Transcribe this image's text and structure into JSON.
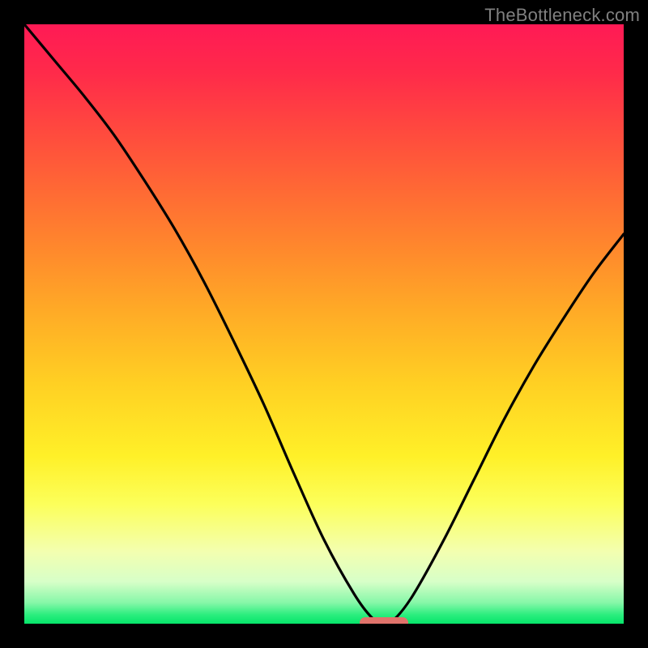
{
  "watermark": "TheBottleneck.com",
  "chart_data": {
    "type": "line",
    "title": "",
    "xlabel": "",
    "ylabel": "",
    "xlim": [
      0,
      100
    ],
    "ylim": [
      0,
      100
    ],
    "x": [
      0,
      5,
      10,
      15,
      20,
      25,
      30,
      35,
      40,
      45,
      50,
      55,
      58,
      60,
      62,
      65,
      70,
      75,
      80,
      85,
      90,
      95,
      100
    ],
    "values": [
      100,
      94,
      88,
      81.5,
      74,
      66,
      57,
      47,
      36.5,
      25,
      14,
      5,
      1,
      0,
      1,
      5,
      14,
      24,
      34,
      43,
      51,
      58.5,
      65
    ],
    "minimum_x": 60,
    "marker": {
      "x_start": 56,
      "x_end": 64,
      "y": 0.2
    },
    "gradient_stops": [
      {
        "pos": 0,
        "color": "#ff1a55"
      },
      {
        "pos": 18,
        "color": "#ff4a3e"
      },
      {
        "pos": 38,
        "color": "#ff8a2c"
      },
      {
        "pos": 60,
        "color": "#ffd023"
      },
      {
        "pos": 80,
        "color": "#fcff5a"
      },
      {
        "pos": 93,
        "color": "#d7ffc8"
      },
      {
        "pos": 100,
        "color": "#06e56a"
      }
    ]
  }
}
